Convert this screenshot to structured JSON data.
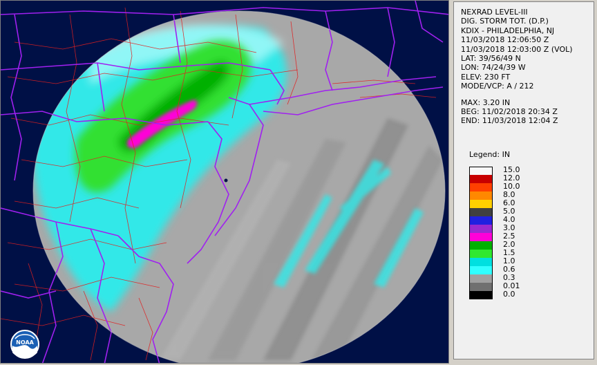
{
  "panel": {
    "lines": [
      "NEXRAD LEVEL-III",
      "DIG. STORM TOT. (D.P.)",
      "KDIX - PHILADELPHIA, NJ",
      "11/03/2018 12:06:50 Z",
      "11/03/2018 12:03:00 Z (VOL)",
      "LAT: 39/56/49 N",
      "LON: 74/24/39 W",
      "ELEV: 230 FT",
      "MODE/VCP: A / 212"
    ],
    "stats": [
      "MAX: 3.20 IN",
      "BEG: 11/02/2018 20:34 Z",
      "END: 11/03/2018 12:04 Z"
    ]
  },
  "legend": {
    "title": "Legend: IN",
    "items": [
      {
        "label": "15.0",
        "color": "#f8f8f8"
      },
      {
        "label": "12.0",
        "color": "#c80000"
      },
      {
        "label": "10.0",
        "color": "#ff4000"
      },
      {
        "label": "8.0",
        "color": "#ff8800"
      },
      {
        "label": "6.0",
        "color": "#ffd000"
      },
      {
        "label": "5.0",
        "color": "#404040"
      },
      {
        "label": "4.0",
        "color": "#2020e0"
      },
      {
        "label": "3.0",
        "color": "#9a2ad0"
      },
      {
        "label": "2.5",
        "color": "#ff00d8"
      },
      {
        "label": "2.0",
        "color": "#00b000"
      },
      {
        "label": "1.5",
        "color": "#30e830"
      },
      {
        "label": "1.0",
        "color": "#00e0e0"
      },
      {
        "label": "0.6",
        "color": "#30ffff"
      },
      {
        "label": "0.3",
        "color": "#a0a0a0"
      },
      {
        "label": "0.01",
        "color": "#707070"
      },
      {
        "label": "0.0",
        "color": "#000000"
      }
    ]
  },
  "map": {
    "background_color": "#001046",
    "county_line_color": "#e02020",
    "state_line_color": "#a020f0",
    "logo_text": "NOAA"
  }
}
